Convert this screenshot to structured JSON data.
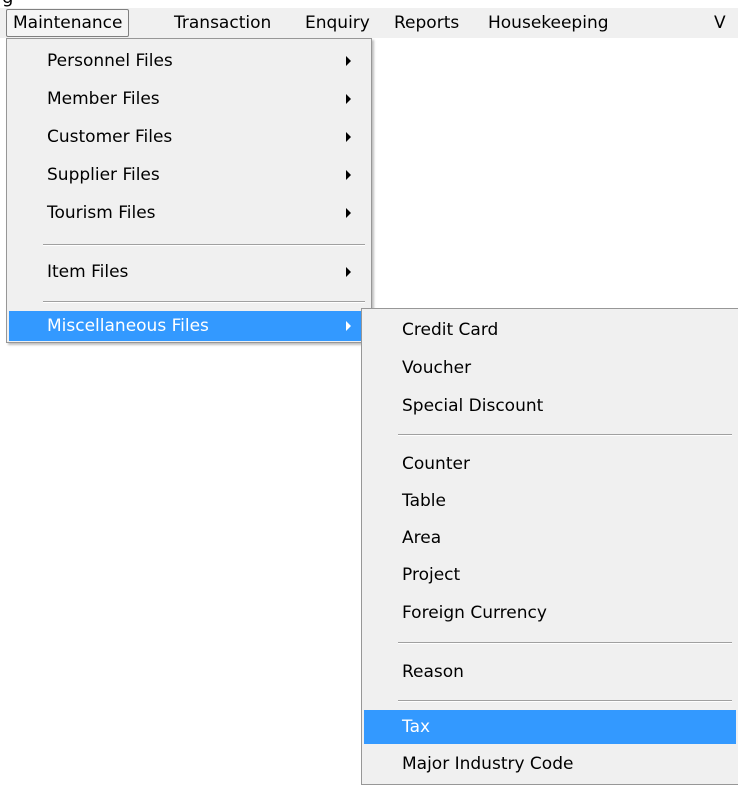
{
  "window": {
    "clipped_title": "g"
  },
  "menubar": {
    "items": [
      {
        "label": "Maintenance"
      },
      {
        "label": "Transaction"
      },
      {
        "label": "Enquiry"
      },
      {
        "label": "Reports"
      },
      {
        "label": "Housekeeping"
      },
      {
        "label": "V"
      }
    ]
  },
  "maintenance_menu": {
    "items": [
      {
        "label": "Personnel Files",
        "has_submenu": true
      },
      {
        "label": "Member Files",
        "has_submenu": true
      },
      {
        "label": "Customer Files",
        "has_submenu": true
      },
      {
        "label": "Supplier Files",
        "has_submenu": true
      },
      {
        "label": "Tourism Files",
        "has_submenu": true
      },
      {
        "label": "Item Files",
        "has_submenu": true
      },
      {
        "label": "Miscellaneous Files",
        "has_submenu": true,
        "highlighted": true
      }
    ]
  },
  "misc_submenu": {
    "items": [
      {
        "label": "Credit Card"
      },
      {
        "label": "Voucher"
      },
      {
        "label": "Special Discount"
      },
      {
        "label": "Counter"
      },
      {
        "label": "Table"
      },
      {
        "label": "Area"
      },
      {
        "label": "Project"
      },
      {
        "label": "Foreign Currency"
      },
      {
        "label": "Reason"
      },
      {
        "label": "Tax",
        "highlighted": true
      },
      {
        "label": "Major Industry Code"
      }
    ]
  },
  "colors": {
    "menu_background": "#f0f0f0",
    "highlight": "#3399ff",
    "highlight_text": "#ffffff",
    "separator": "#a0a0a0"
  }
}
